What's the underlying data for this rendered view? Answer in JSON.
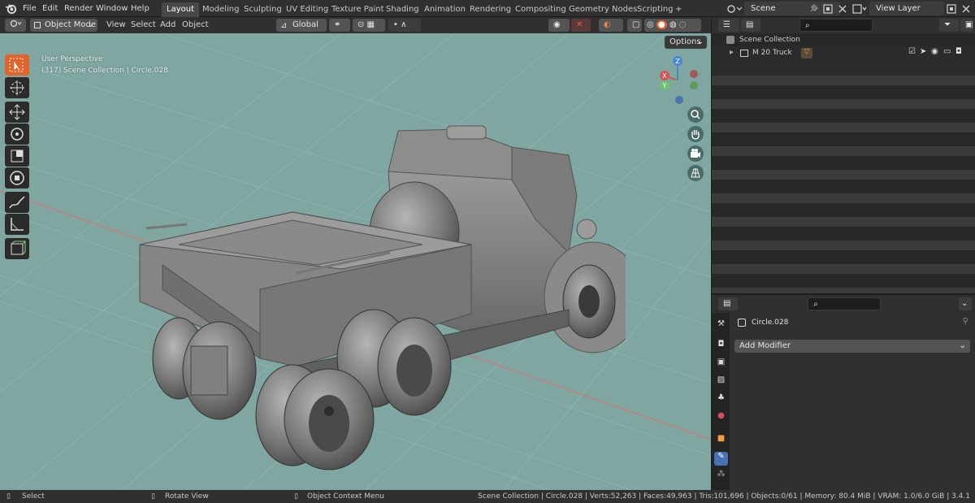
{
  "topbar": {
    "menus": [
      "File",
      "Edit",
      "Render",
      "Window",
      "Help"
    ],
    "workspaces": [
      "Layout",
      "Modeling",
      "Sculpting",
      "UV Editing",
      "Texture Paint",
      "Shading",
      "Animation",
      "Rendering",
      "Compositing",
      "Geometry Nodes",
      "Scripting"
    ],
    "active_workspace": "Layout",
    "add_workspace": "+",
    "scene": "Scene",
    "view_layer": "View Layer"
  },
  "viewport_header": {
    "mode": "Object Mode",
    "menus": [
      "View",
      "Select",
      "Add",
      "Object"
    ],
    "transform_orientation": "Global"
  },
  "viewport": {
    "perspective": "User Perspective",
    "context": "(317) Scene Collection | Circle.028",
    "options_label": "Options",
    "gizmo": {
      "x": "X",
      "y": "Y",
      "z": "Z"
    },
    "tools": [
      "select-box-icon",
      "cursor-icon",
      "move-icon",
      "rotate-icon",
      "scale-icon",
      "transform-icon",
      "annotate-icon",
      "measure-icon",
      "add-cube-icon"
    ],
    "nav": [
      "zoom-icon",
      "hand-icon",
      "camera-icon",
      "ortho-grid-icon"
    ],
    "colors": {
      "background": "#7fa6a1",
      "grid": "#8fb3ae",
      "x_axis": "#c86b6b",
      "active_tool": "#e0642c"
    }
  },
  "outliner": {
    "root": "Scene Collection",
    "items": [
      {
        "name": "M 20 Truck"
      }
    ]
  },
  "properties": {
    "object_name": "Circle.028",
    "add_modifier": "Add Modifier"
  },
  "statusbar": {
    "select": "Select",
    "rotate": "Rotate View",
    "context_menu": "Object Context Menu",
    "stats": "Scene Collection | Circle.028 | Verts:52,263 | Faces:49,963 | Tris:101,696 | Objects:0/61 | Memory: 80.4 MiB | VRAM: 1.0/6.0 GiB | 3.4.1"
  }
}
